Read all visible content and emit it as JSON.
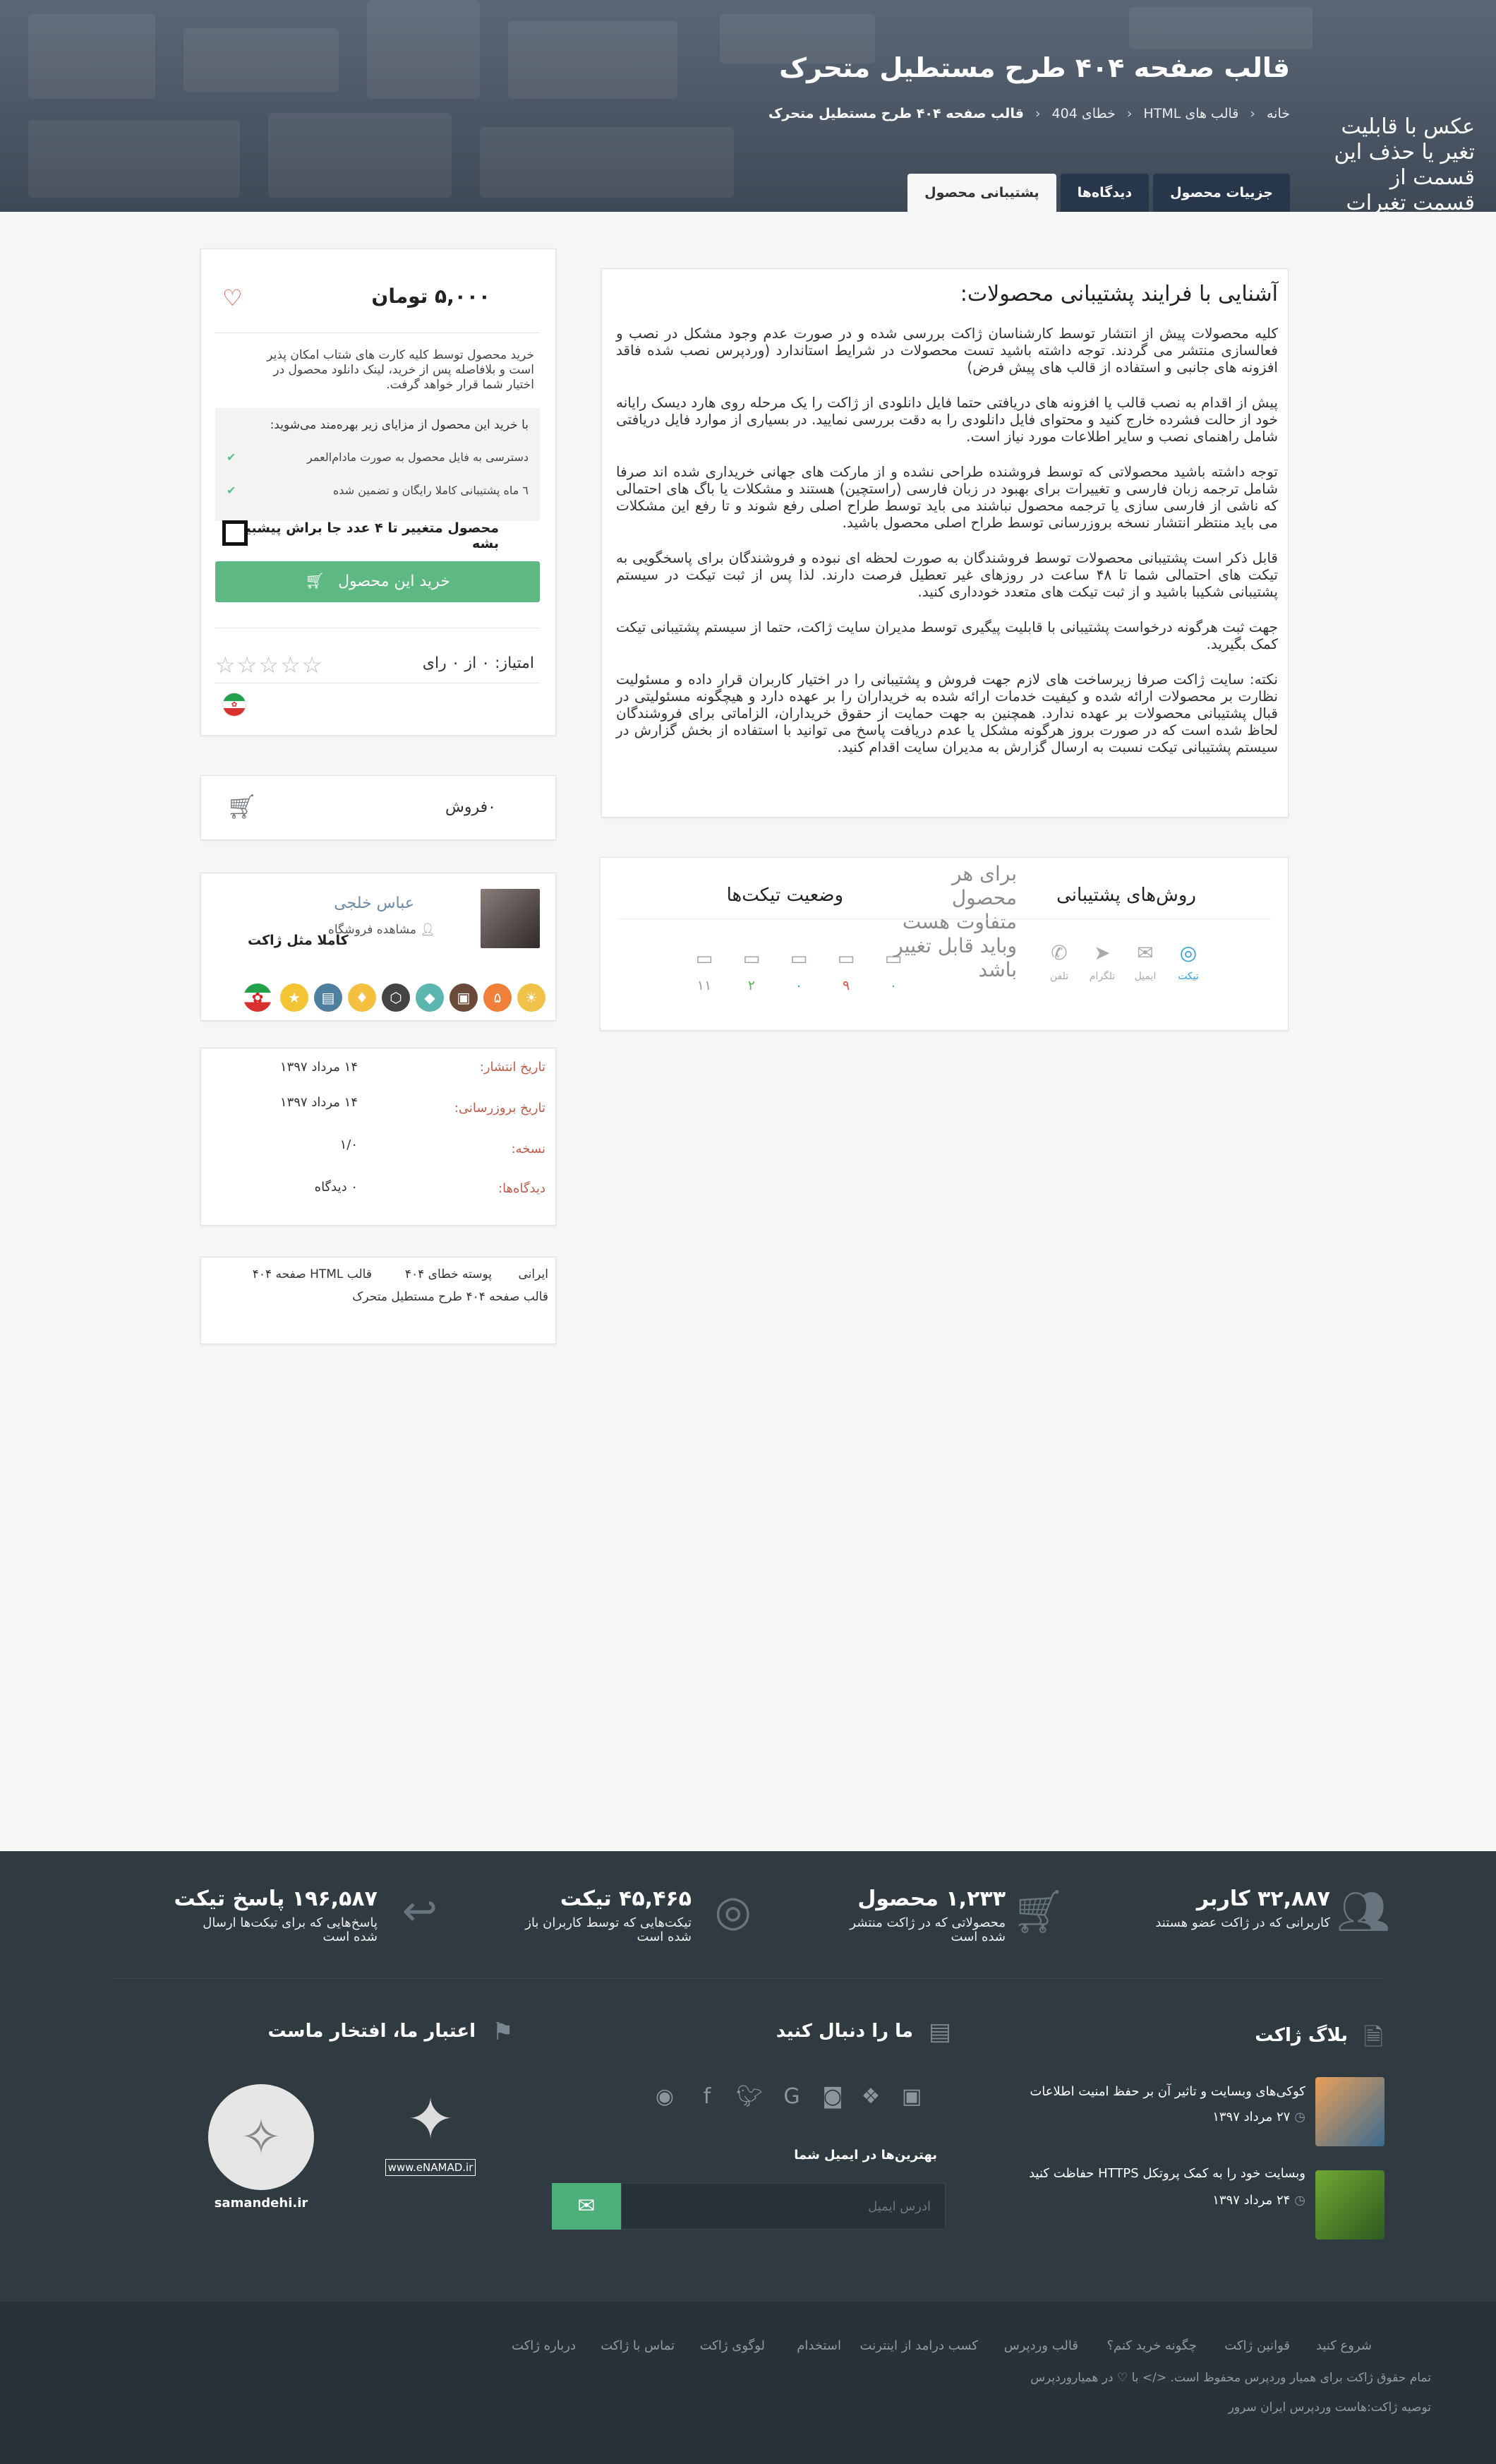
{
  "hero": {
    "title": "قالب صفحه ۴۰۴ طرح مستطیل متحرک",
    "breadcrumb": [
      "خانه",
      "قالب های HTML",
      "خطای 404",
      "قالب صفحه ۴۰۴ طرح مستطیل متحرک"
    ],
    "side_note": "عکس با قابلیت تغیر یا حذف این قسمت از قسمت تغیرات قالب",
    "tabs": [
      "جزییات محصول",
      "دیدگاه‌ها",
      "پشتیبانی محصول"
    ]
  },
  "article": {
    "heading": "آشنایی با فرایند پشتیبانی محصولات:",
    "paragraphs": [
      "کلیه محصولات پیش از انتشار توسط کارشناسان ژاکت بررسی شده و در صورت عدم وجود مشکل در نصب و فعالسازی منتشر می گردند. توجه داشته باشید تست محصولات در شرایط استاندارد (وردپرس نصب شده فاقد افزونه های جانبی و استفاده از قالب های پیش فرض)",
      "پیش از اقدام به نصب قالب یا افزونه های دریافتی حتما فایل دانلودی از ژاکت را یک مرحله روی هارد دیسک رایانه خود از حالت فشرده خارج کنید و محتوای فایل دانلودی را به دقت بررسی نمایید. در بسیاری از موارد فایل دریافتی شامل راهنمای نصب و سایر اطلاعات مورد نیاز است.",
      "توجه داشته باشید محصولاتی که توسط فروشنده طراحی نشده و از مارکت های جهانی خریداری شده اند صرفا شامل ترجمه زبان فارسی و تغییرات برای بهبود در زبان فارسی (راستچین) هستند و مشکلات یا باگ های احتمالی که ناشی از فارسی سازی یا ترجمه محصول نباشند می باید توسط طراح اصلی رفع شوند و تا رفع این مشکلات می باید منتظر انتشار نسخه بروزرسانی توسط طراح اصلی محصول باشید.",
      "قابل ذکر است پشتیبانی محصولات توسط فروشندگان به صورت لحظه ای نبوده و فروشندگان برای پاسخگویی به تیکت های احتمالی شما تا ۴۸ ساعت در روزهای غیر تعطیل فرصت دارند. لذا پس از ثبت تیکت در سیستم پشتیبانی شکیبا باشید و از ثبت تیکت های متعدد خودداری کنید.",
      "جهت ثبت هرگونه درخواست پشتیبانی با قابلیت پیگیری توسط مدیران سایت ژاکت، حتما از سیستم پشتیبانی تیکت کمک بگیرید.",
      "نکته: سایت ژاکت صرفا زیرساخت های لازم جهت فروش و پشتیبانی را در اختیار کاربران قرار داده و مسئولیت نظارت بر محصولات ارائه شده و کیفیت خدمات ارائه شده به خریداران را بر عهده دارد و هیچگونه مسئولیتی در قبال پشتیبانی محصولات بر عهده ندارد. همچنین به جهت حمایت از حقوق خریداران، الزاماتی برای فروشندگان لحاظ شده است که در صورت بروز هرگونه مشکل یا عدم دریافت پاسخ می توانید با استفاده از بخش گزارش در سیستم پشتیبانی تیکت نسبت به ارسال گزارش به مدیران سایت اقدام کنید."
    ]
  },
  "support": {
    "methods_title": "روش‌های پشتیبانی",
    "note": "برای هر محصول متفاوت هست وباید قابل تغییر باشد",
    "status_title": "وضعیت تیکت‌ها",
    "methods": [
      "تیکت",
      "ایمیل",
      "تلگرام",
      "تلفن"
    ],
    "ticket_counts": [
      "۰",
      "۹",
      "۰",
      "۲",
      "۱۱"
    ],
    "ticket_colors": [
      "#5cb85c",
      "#e0513e",
      "#2fa0c9",
      "#5cb85c",
      "#999999"
    ]
  },
  "purchase": {
    "price": "۵,۰۰۰ تومان",
    "description": "خرید محصول توسط کلیه کارت های شتاب امکان پذیر است و بلافاصله پس از خرید، لینک دانلود محصول در اختیار شما قرار خواهد گرفت.",
    "benefits_title": "با خرید این محصول از مزایای زیر بهره‌مند می‌شوید:",
    "benefits": [
      "دسترسی به فایل محصول به صورت مادام‌العمر",
      "٦ ماه پشتیبانی کاملا رایگان و تضمین شده"
    ],
    "variable_label": "محصول متغییر تا ۴ عدد جا براش پیشبینی بشه",
    "buy_label": "خرید این محصول",
    "rating": "امتیاز: ۰ از ۰ رای",
    "stars": "☆☆☆☆☆"
  },
  "sales": {
    "label": "۰فروش"
  },
  "author": {
    "name": "عباس خلجی",
    "view_label": "مشاهده فروشگاه",
    "tagline": "کاملا مثل ژاکت"
  },
  "meta": [
    {
      "label": "تاریخ انتشار:",
      "value": "۱۴ مرداد ۱۳۹۷"
    },
    {
      "label": "تاریخ بروزرسانی:",
      "value": "۱۴ مرداد ۱۳۹۷"
    },
    {
      "label": "نسخه:",
      "value": "۱/۰"
    },
    {
      "label": "دیدگاه‌ها:",
      "value": "۰ دیدگاه"
    }
  ],
  "tags": [
    "ایرانی",
    "پوسته خطای ۴۰۴",
    "قالب HTML صفحه ۴۰۴",
    "قالب صفحه ۴۰۴ طرح مستطیل متحرک"
  ],
  "stats": [
    {
      "big": "۳۲,۸۸۷ کاربر",
      "small": "کاربرانی که در ژاکت عضو هستند"
    },
    {
      "big": "۱,۲۳۳ محصول",
      "small": "محصولاتی که در ژاکت منتشر شده است"
    },
    {
      "big": "۴۵,۴۶۵ تیکت",
      "small": "تیکت‌هایی که توسط کاربران باز شده است"
    },
    {
      "big": "۱۹۶,۵۸۷ پاسخ تیکت",
      "small": "پاسخ‌هایی که برای تیکت‌ها ارسال شده است"
    }
  ],
  "blog": {
    "title": "بلاگ ژاکت",
    "posts": [
      {
        "title": "کوکی‌های وبسایت و تاثیر آن بر حفظ امنیت اطلاعات",
        "date": "۲۷ مرداد ۱۳۹۷"
      },
      {
        "title": "وبسایت خود را به کمک پروتکل HTTPS حفاظت کنید",
        "date": "۲۴ مرداد ۱۳۹۷"
      }
    ]
  },
  "follow": {
    "title": "ما را دنبال کنید",
    "newsletter_label": "بهترین‌ها در ایمیل شما",
    "email_placeholder": "ادرس ایمیل"
  },
  "trust": {
    "title": "اعتبار ما، افتخار ماست",
    "enamad": "www.eNAMAD.ir",
    "samandehi": "samandehi.ir"
  },
  "bottom": {
    "links": [
      "شروع کنید",
      "قوانین ژاکت",
      "چگونه خرید کنم؟",
      "قالب وردپرس",
      "کسب درامد از اینترنت",
      "استخدام",
      "لوگوی ژاکت",
      "تماس با ژاکت",
      "درباره ژاکت"
    ],
    "copyright": "تمام حقوق ژاکت برای همیار وردپرس محفوظ است. </> با ♡ در همیاروردپرس",
    "hosting": "توصیه ژاکت:هاست وردپرس ایران سرور"
  }
}
